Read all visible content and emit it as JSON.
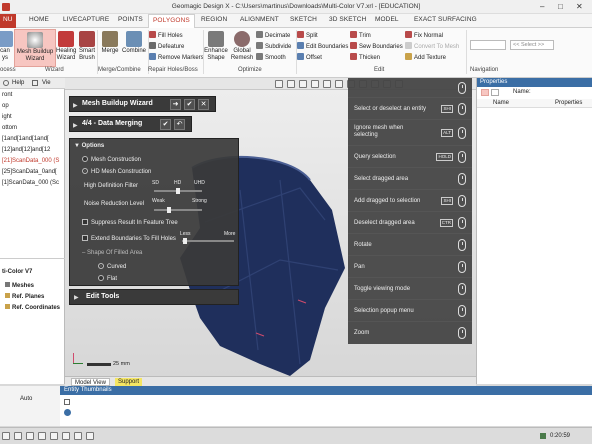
{
  "app": {
    "title": "Geomagic Design X - C:\\Users\\martinus\\Downloads\\Multi-Color V7.xrl - [EDUCATION]"
  },
  "menu_tabs": [
    {
      "label": "NU",
      "active": false
    },
    {
      "label": "HOME",
      "active": false
    },
    {
      "label": "LIVECAPTURE",
      "active": false
    },
    {
      "label": "POINTS",
      "active": false
    },
    {
      "label": "POLYGONS",
      "active": true
    },
    {
      "label": "REGION",
      "active": false
    },
    {
      "label": "ALIGNMENT",
      "active": false
    },
    {
      "label": "SKETCH",
      "active": false
    },
    {
      "label": "3D SKETCH",
      "active": false
    },
    {
      "label": "MODEL",
      "active": false
    },
    {
      "label": "EXACT SURFACING",
      "active": false
    }
  ],
  "ribbon": {
    "large_buttons": [
      {
        "label": "can\nys",
        "icon": "scan-icon"
      },
      {
        "label": "Mesh Buildup\nWizard",
        "icon": "mesh-buildup-icon",
        "active": true
      },
      {
        "label": "Healing\nWizard",
        "icon": "healing-icon"
      },
      {
        "label": "Smart\nBrush",
        "icon": "brush-icon"
      },
      {
        "label": "Merge",
        "icon": "merge-icon"
      },
      {
        "label": "Combine",
        "icon": "combine-icon"
      },
      {
        "label": "Enhance\nShape",
        "icon": "enhance-icon"
      },
      {
        "label": "Global\nRemesh",
        "icon": "remesh-icon"
      }
    ],
    "small_buttons": [
      "Fill Holes",
      "Defeature",
      "Remove Markers",
      "Decimate",
      "Subdivide",
      "Smooth",
      "Split",
      "Edit Boundaries",
      "Offset",
      "Trim",
      "Sew Boundaries",
      "Thicken",
      "Fix Normal",
      "Convert To Mesh",
      "Add Texture"
    ],
    "nav_select_placeholder": "<< Select >>",
    "groups": [
      "ocess",
      "Wizard",
      "Merge/Combine",
      "Repair Holes/Boss",
      "Optimize",
      "Edit",
      "Navigation"
    ]
  },
  "left_panel": {
    "header_help": "Help",
    "header_view": "Vie",
    "items": [
      "ront",
      "op",
      "ight",
      "ottom",
      "[1and[1and[1and[",
      "[12]and[12]and[12",
      "[21]ScanData_000 (S",
      "[25]ScanData_0and[",
      "[1]ScanData_000 (Sc"
    ],
    "bottom_title": "ti-Color V7",
    "bottom_items": [
      "Meshes",
      "Ref. Planes",
      "Ref. Coordinates"
    ]
  },
  "wizard": {
    "title": "Mesh Buildup Wizard",
    "step": "4/4 - Data Merging",
    "options_title": "Options",
    "construction": [
      "Mesh Construction",
      "HD Mesh Construction"
    ],
    "selected_construction": 1,
    "hd_filter_label": "High Definition Filter",
    "hd_levels": [
      "SD",
      "HD",
      "UHD"
    ],
    "hd_value_fraction": 0.5,
    "noise_label": "Noise Reduction Level",
    "noise_levels": [
      "Weak",
      "Strong"
    ],
    "noise_value_fraction": 0.3,
    "suppress_label": "Suppress Result In Feature Tree",
    "extend_label": "Extend Boundaries To Fill Holes",
    "extend_levels": [
      "Less",
      "More"
    ],
    "extend_value_fraction": 0.02,
    "shape_label": "Shape Of Filled Area",
    "shape_options": [
      "Curved",
      "Flat"
    ],
    "selected_shape": 0,
    "edit_tools": "Edit Tools"
  },
  "help_panel": [
    {
      "label": "Select or deselect an entity",
      "key": "SHI"
    },
    {
      "label": "Ignore mesh when\nselecting",
      "key": "ALT"
    },
    {
      "label": "Query selection",
      "key": "HOLD"
    },
    {
      "label": "Select dragged area",
      "key": ""
    },
    {
      "label": "Add dragged to selection",
      "key": "SHI"
    },
    {
      "label": "Deselect dragged area",
      "key": "CTR"
    },
    {
      "label": "Rotate",
      "key": ""
    },
    {
      "label": "Pan",
      "key": ""
    },
    {
      "label": "Toggle viewing mode",
      "key": ""
    },
    {
      "label": "Selection popup menu",
      "key": ""
    },
    {
      "label": "Zoom",
      "key": ""
    }
  ],
  "properties": {
    "title": "Properties",
    "name_label": "Name:",
    "col_name": "Name",
    "col_props": "Properties"
  },
  "viewport": {
    "scale_label": "25 mm",
    "tabs": [
      "Model View",
      "Support"
    ],
    "active_tab": 0
  },
  "bottom": {
    "thumbs_title": "Entity Thumbnails",
    "auto_label": "Auto",
    "timer": "0:20:59"
  },
  "colors": {
    "accent": "#c0392b",
    "panel": "#3a3a3a",
    "mesh": "#1f2f5c",
    "support_tab": "#f5e663"
  }
}
